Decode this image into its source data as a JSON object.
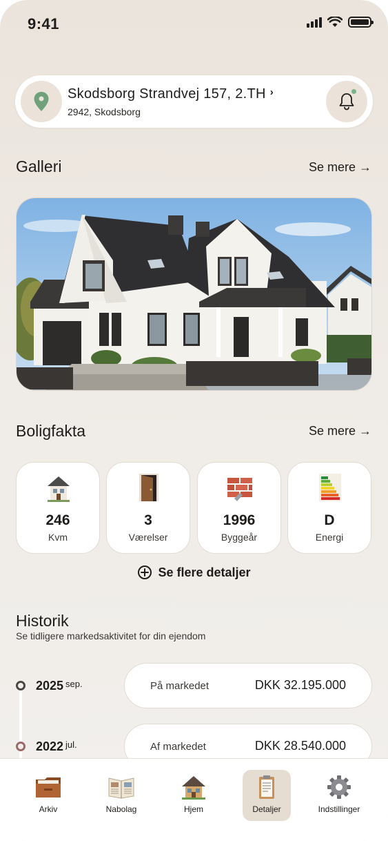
{
  "status_bar": {
    "time": "9:41"
  },
  "address": {
    "street": "Skodsborg Strandvej 157, 2.TH",
    "chevron": "›",
    "city": "2942, Skodsborg",
    "pin_icon": "location-pin-icon",
    "bell_icon": "bell-icon",
    "notification_dot_color": "#7bb48a"
  },
  "gallery": {
    "title": "Galleri",
    "see_more": "Se mere →"
  },
  "facts": {
    "title": "Boligfakta",
    "see_more": "Se mere →",
    "items": [
      {
        "value": "246",
        "label": "Kvm",
        "icon": "house-icon"
      },
      {
        "value": "3",
        "label": "Værelser",
        "icon": "door-icon"
      },
      {
        "value": "1996",
        "label": "Byggeår",
        "icon": "bricks-icon"
      },
      {
        "value": "D",
        "label": "Energi",
        "icon": "energy-label-icon"
      }
    ],
    "more_details": "Se flere detaljer",
    "more_details_icon": "plus-circle-icon"
  },
  "history": {
    "title": "Historik",
    "subtitle": "Se tidligere markedsaktivitet for din ejendom",
    "entries": [
      {
        "year": "2025",
        "month": "sep.",
        "status": "På markedet",
        "price": "DKK 32.195.000",
        "dot_color": "#4a4744"
      },
      {
        "year": "2022",
        "month": "jul.",
        "status": "Af markedet",
        "price": "DKK 28.540.000",
        "dot_color": "#9a6a6a"
      }
    ]
  },
  "nav": {
    "items": [
      {
        "label": "Arkiv",
        "icon": "folder-icon"
      },
      {
        "label": "Nabolag",
        "icon": "open-book-icon"
      },
      {
        "label": "Hjem",
        "icon": "home-icon"
      },
      {
        "label": "Detaljer",
        "icon": "clipboard-icon",
        "active": true
      },
      {
        "label": "Indstillinger",
        "icon": "gear-icon"
      }
    ]
  }
}
